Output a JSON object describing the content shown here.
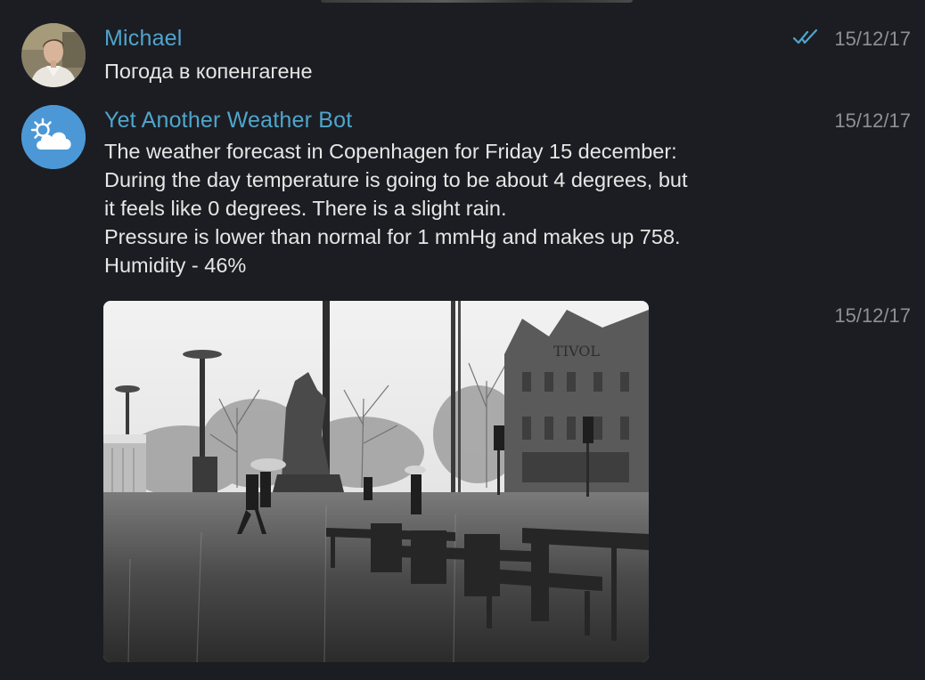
{
  "messages": [
    {
      "sender": "Michael",
      "text": "Погода в копенгагене",
      "time": "15/12/17",
      "status_icon": "double-check-icon",
      "avatar_icon": "user-photo-avatar"
    },
    {
      "sender": "Yet Another Weather Bot",
      "text": "The weather forecast in Copenhagen for Friday 15 december:\nDuring the day temperature is going to be about 4 degrees, but\nit feels like 0 degrees. There is a slight rain.\nPressure is lower than normal for 1 mmHg and makes up 758.\nHumidity - 46%",
      "time": "15/12/17",
      "avatar_icon": "sun-cloud-icon"
    },
    {
      "time": "15/12/17",
      "attachment": "rainy-street-photo"
    }
  ],
  "colors": {
    "background": "#1c1d22",
    "sender_name": "#4ea5cc",
    "timestamp": "#8e9097",
    "bot_avatar": "#4c98d6",
    "read_check": "#4ea5cc"
  }
}
